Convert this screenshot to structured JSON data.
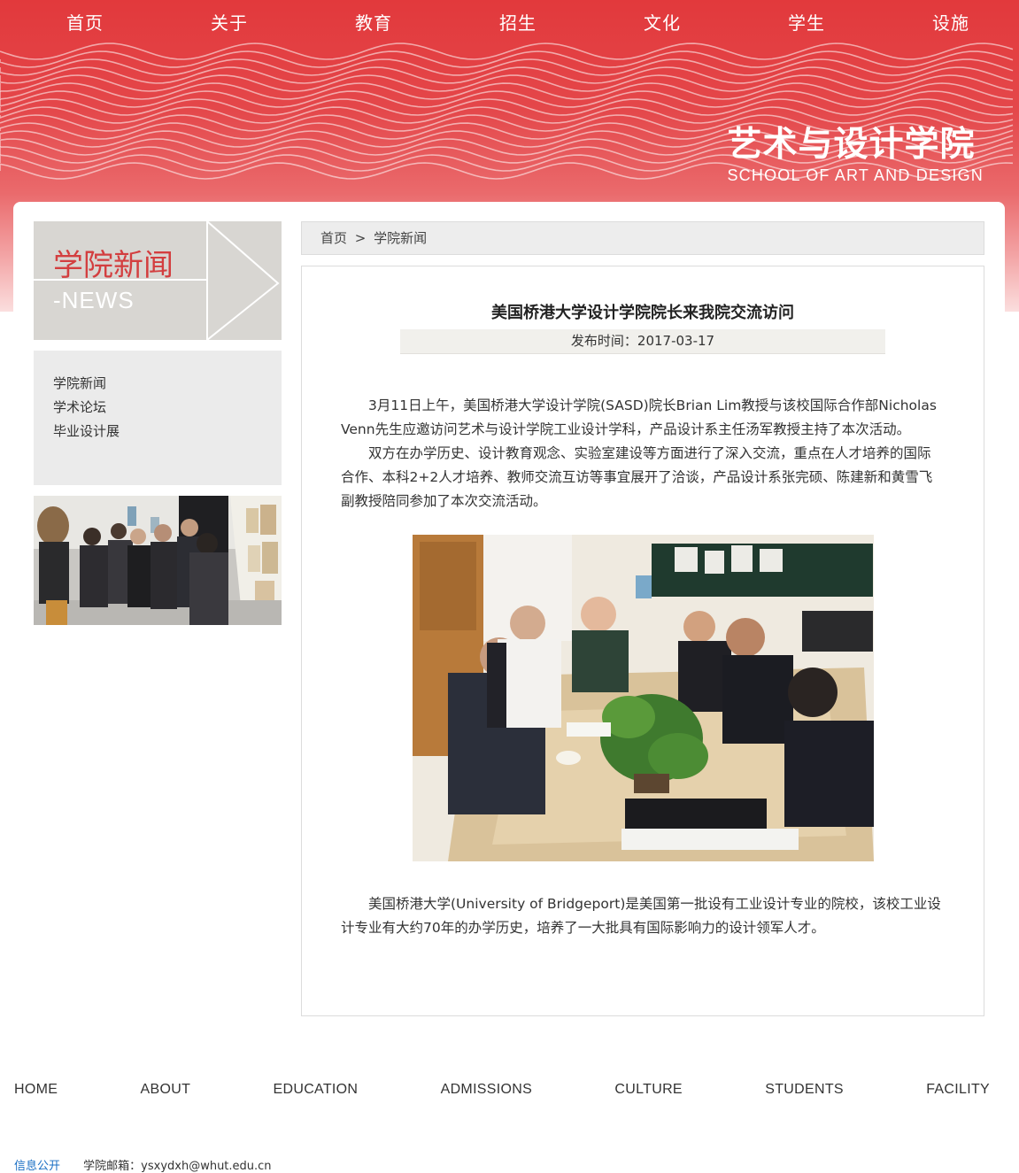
{
  "top_nav": [
    "首页",
    "关于",
    "教育",
    "招生",
    "文化",
    "学生",
    "设施"
  ],
  "brand": {
    "cn": "艺术与设计学院",
    "en": "SCHOOL OF ART AND DESIGN"
  },
  "sidebar": {
    "title_cn": "学院新闻",
    "title_en": "-NEWS",
    "items": [
      {
        "label": "学院新闻"
      },
      {
        "label": "学术论坛"
      },
      {
        "label": "毕业设计展"
      }
    ]
  },
  "breadcrumb": {
    "home": "首页",
    "separator": ">",
    "current": "学院新闻"
  },
  "article": {
    "title": "美国桥港大学设计学院院长来我院交流访问",
    "date": "发布时间：2017-03-17",
    "paragraphs": [
      "3月11日上午，美国桥港大学设计学院(SASD)院长Brian Lim教授与该校国际合作部Nicholas Venn先生应邀访问艺术与设计学院工业设计学科，产品设计系主任汤军教授主持了本次活动。",
      "双方在办学历史、设计教育观念、实验室建设等方面进行了深入交流，重点在人才培养的国际合作、本科2+2人才培养、教师交流互访等事宜展开了洽谈，产品设计系张完硕、陈建新和黄雪飞副教授陪同参加了本次交流活动。"
    ],
    "paragraph_after": "美国桥港大学(University of Bridgeport)是美国第一批设有工业设计专业的院校，该校工业设计专业有大约70年的办学历史，培养了一大批具有国际影响力的设计领军人才。"
  },
  "footer_nav": [
    "HOME",
    "ABOUT",
    "EDUCATION",
    "ADMISSIONS",
    "CULTURE",
    "STUDENTS",
    "FACILITY"
  ],
  "footer_info": {
    "link": "信息公开",
    "email": "学院邮箱：ysxydxh@whut.edu.cn"
  },
  "colors": {
    "banner_red": "#e2393c",
    "sidebar_title_red": "#d33e3f",
    "link_blue": "#1a6fc4"
  }
}
